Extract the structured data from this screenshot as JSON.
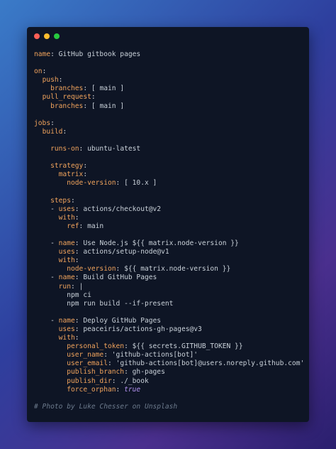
{
  "window": {
    "controls": [
      "close",
      "minimize",
      "maximize"
    ],
    "colors": {
      "close": "#ff5f56",
      "minimize": "#ffbd2e",
      "maximize": "#27c93f"
    }
  },
  "colors": {
    "key": "#f0a35c",
    "text": "#d4d8de",
    "bool": "#b392f0",
    "comment": "#6c7a8c",
    "background": "#0e1525"
  },
  "code": [
    {
      "indent": "",
      "key": "name",
      "value": "GitHub gitbook pages"
    },
    {},
    {
      "indent": "",
      "key": "on",
      "value": ""
    },
    {
      "indent": "  ",
      "key": "push",
      "value": ""
    },
    {
      "indent": "    ",
      "key": "branches",
      "value": "[ main ]"
    },
    {
      "indent": "  ",
      "key": "pull_request",
      "value": ""
    },
    {
      "indent": "    ",
      "key": "branches",
      "value": "[ main ]"
    },
    {},
    {
      "indent": "",
      "key": "jobs",
      "value": ""
    },
    {
      "indent": "  ",
      "key": "build",
      "value": ""
    },
    {},
    {
      "indent": "    ",
      "key": "runs-on",
      "value": "ubuntu-latest"
    },
    {},
    {
      "indent": "    ",
      "key": "strategy",
      "value": ""
    },
    {
      "indent": "      ",
      "key": "matrix",
      "value": ""
    },
    {
      "indent": "        ",
      "key": "node-version",
      "value": "[ 10.x ]"
    },
    {},
    {
      "indent": "    ",
      "key": "steps",
      "value": ""
    },
    {
      "indent": "    ",
      "prefix": "- ",
      "key": "uses",
      "value": "actions/checkout@v2"
    },
    {
      "indent": "      ",
      "key": "with",
      "value": ""
    },
    {
      "indent": "        ",
      "key": "ref",
      "value": "main"
    },
    {},
    {
      "indent": "    ",
      "prefix": "- ",
      "key": "name",
      "value": "Use Node.js ${{ matrix.node-version }}"
    },
    {
      "indent": "      ",
      "key": "uses",
      "value": "actions/setup-node@v1"
    },
    {
      "indent": "      ",
      "key": "with",
      "value": ""
    },
    {
      "indent": "        ",
      "key": "node-version",
      "value": "${{ matrix.node-version }}"
    },
    {
      "indent": "    ",
      "prefix": "- ",
      "key": "name",
      "value": "Build GitHub Pages"
    },
    {
      "indent": "      ",
      "key": "run",
      "value": "|"
    },
    {
      "indent": "        ",
      "text": "npm ci"
    },
    {
      "indent": "        ",
      "text": "npm run build --if-present"
    },
    {},
    {
      "indent": "    ",
      "prefix": "- ",
      "key": "name",
      "value": "Deploy GitHub Pages"
    },
    {
      "indent": "      ",
      "key": "uses",
      "value": "peaceiris/actions-gh-pages@v3"
    },
    {
      "indent": "      ",
      "key": "with",
      "value": ""
    },
    {
      "indent": "        ",
      "key": "personal_token",
      "value": "${{ secrets.GITHUB_TOKEN }}"
    },
    {
      "indent": "        ",
      "key": "user_name",
      "value": "'github-actions[bot]'"
    },
    {
      "indent": "        ",
      "key": "user_email",
      "value": "'github-actions[bot]@users.noreply.github.com'"
    },
    {
      "indent": "        ",
      "key": "publish_branch",
      "value": "gh-pages"
    },
    {
      "indent": "        ",
      "key": "publish_dir",
      "value": "./_book"
    },
    {
      "indent": "        ",
      "key": "force_orphan",
      "value": "true",
      "bool": true
    },
    {},
    {
      "indent": "",
      "comment": "# Photo by Luke Chesser on Unsplash"
    }
  ]
}
